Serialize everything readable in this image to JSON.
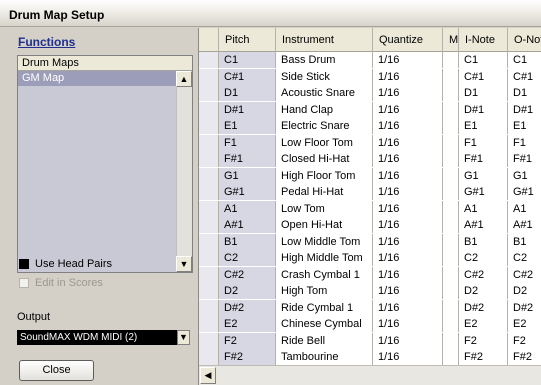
{
  "window": {
    "title": "Drum Map Setup"
  },
  "left_panel": {
    "functions_label": "Functions",
    "drum_maps_header": "Drum Maps",
    "drum_maps": [
      "GM Map"
    ],
    "use_head_pairs_label": "Use Head Pairs",
    "edit_in_scores_label": "Edit in Scores",
    "output_label": "Output",
    "output_value": "SoundMAX WDM MIDI (2)",
    "close_label": "Close"
  },
  "table": {
    "columns": [
      "Pitch",
      "Instrument",
      "Quantize",
      "M",
      "I-Note",
      "O-Note"
    ],
    "rows": [
      [
        "C1",
        "Bass Drum",
        "1/16",
        "C1",
        "C1"
      ],
      [
        "C#1",
        "Side Stick",
        "1/16",
        "C#1",
        "C#1"
      ],
      [
        "D1",
        "Acoustic Snare",
        "1/16",
        "D1",
        "D1"
      ],
      [
        "D#1",
        "Hand Clap",
        "1/16",
        "D#1",
        "D#1"
      ],
      [
        "E1",
        "Electric Snare",
        "1/16",
        "E1",
        "E1"
      ],
      [
        "F1",
        "Low Floor Tom",
        "1/16",
        "F1",
        "F1"
      ],
      [
        "F#1",
        "Closed Hi-Hat",
        "1/16",
        "F#1",
        "F#1"
      ],
      [
        "G1",
        "High Floor Tom",
        "1/16",
        "G1",
        "G1"
      ],
      [
        "G#1",
        "Pedal Hi-Hat",
        "1/16",
        "G#1",
        "G#1"
      ],
      [
        "A1",
        "Low Tom",
        "1/16",
        "A1",
        "A1"
      ],
      [
        "A#1",
        "Open Hi-Hat",
        "1/16",
        "A#1",
        "A#1"
      ],
      [
        "B1",
        "Low Middle Tom",
        "1/16",
        "B1",
        "B1"
      ],
      [
        "C2",
        "High Middle Tom",
        "1/16",
        "C2",
        "C2"
      ],
      [
        "C#2",
        "Crash Cymbal 1",
        "1/16",
        "C#2",
        "C#2"
      ],
      [
        "D2",
        "High Tom",
        "1/16",
        "D2",
        "D2"
      ],
      [
        "D#2",
        "Ride Cymbal 1",
        "1/16",
        "D#2",
        "D#2"
      ],
      [
        "E2",
        "Chinese Cymbal",
        "1/16",
        "E2",
        "E2"
      ],
      [
        "F2",
        "Ride Bell",
        "1/16",
        "F2",
        "F2"
      ],
      [
        "F#2",
        "Tambourine",
        "1/16",
        "F#2",
        "F#2"
      ]
    ]
  },
  "icons": {
    "scroll_up": "▲",
    "scroll_down": "▼",
    "scroll_left": "◀",
    "dropdown": "▼"
  }
}
